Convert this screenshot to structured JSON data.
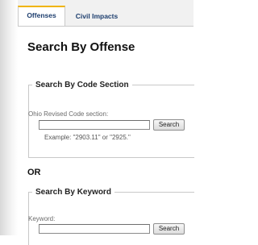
{
  "tabs": [
    {
      "label": "Offenses",
      "active": true
    },
    {
      "label": "Civil Impacts",
      "active": false
    }
  ],
  "page_title": "Search By Offense",
  "code_section": {
    "legend": "Search By Code Section",
    "field_label": "Ohio Revised Code section:",
    "input_value": "",
    "button_label": "Search",
    "example": "Example: \"2903.11\" or \"2925.\""
  },
  "or_label": "OR",
  "keyword": {
    "legend": "Search By Keyword",
    "field_label": "Keyword:",
    "input_value": "",
    "button_label": "Search"
  },
  "colors": {
    "tab_accent": "#f0b400",
    "tab_text": "#1d3e6e"
  }
}
